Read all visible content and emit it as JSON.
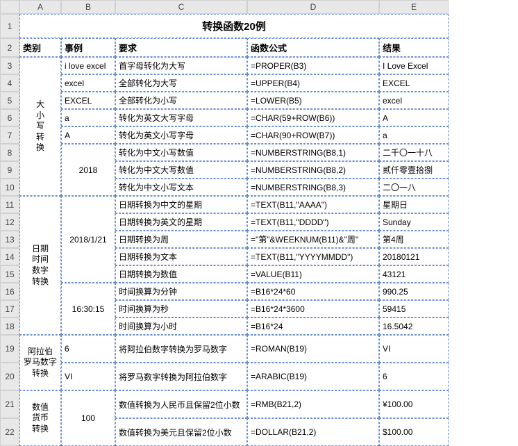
{
  "colHeaders": [
    "A",
    "B",
    "C",
    "D",
    "E"
  ],
  "rowHeaders": [
    "1",
    "2",
    "3",
    "4",
    "5",
    "6",
    "7",
    "8",
    "9",
    "10",
    "11",
    "12",
    "13",
    "14",
    "15",
    "16",
    "17",
    "18",
    "19",
    "20",
    "21",
    "22"
  ],
  "title": "转换函数20例",
  "headers": {
    "a": "类别",
    "b": "事例",
    "c": "要求",
    "d": "函数公式",
    "e": "结果"
  },
  "cat": {
    "case": [
      "大",
      "小",
      "写",
      "转",
      "换"
    ],
    "date": [
      "日期",
      "时间",
      "数字",
      "转换"
    ],
    "roman": [
      "阿拉伯",
      "罗马数字",
      "转换"
    ],
    "money": [
      "数值",
      "货币",
      "转换"
    ]
  },
  "ex": {
    "b3": "i love excel",
    "b4": "excel",
    "b5": "EXCEL",
    "b6": "a",
    "b7": "A",
    "b8": "2018",
    "b11": "2018/1/21",
    "b16": "16:30:15",
    "b19": "6",
    "b20": "VI",
    "b21": "100"
  },
  "req": {
    "r3": "首字母转化为大写",
    "r4": "全部转化为大写",
    "r5": "全部转化为小写",
    "r6": "转化为英文大写字母",
    "r7": "转化为英文小写字母",
    "r8": "转化为中文小写数值",
    "r9": "转化为中文大写数值",
    "r10": "转化为中文小写文本",
    "r11": "日期转换为中文的星期",
    "r12": "日期转换为英文的星期",
    "r13": "日期转换为周",
    "r14": "日期转换为文本",
    "r15": "日期转换为数值",
    "r16": "时间换算为分钟",
    "r17": "时间换算为秒",
    "r18": "时间换算为小时",
    "r19": "将阿拉伯数字转换为罗马数字",
    "r20": "将罗马数字转换为阿拉伯数字",
    "r21": "数值转换为人民币且保留2位小数",
    "r22": "数值转换为美元且保留2位小数"
  },
  "fn": {
    "f3": "=PROPER(B3)",
    "f4": "=UPPER(B4)",
    "f5": "=LOWER(B5)",
    "f6": "=CHAR(59+ROW(B6))",
    "f7": "=CHAR(90+ROW(B7))",
    "f8": "=NUMBERSTRING(B8,1)",
    "f9": "=NUMBERSTRING(B8,2)",
    "f10": "=NUMBERSTRING(B8,3)",
    "f11": "=TEXT(B11,\"AAAA\")",
    "f12": "=TEXT(B11,\"DDDD\")",
    "f13": "=\"第\"&WEEKNUM(B11)&\"周\"",
    "f14": "=TEXT(B11,\"YYYYMMDD\")",
    "f15": "=VALUE(B11)",
    "f16": "=B16*24*60",
    "f17": "=B16*24*3600",
    "f18": "=B16*24",
    "f19": "=ROMAN(B19)",
    "f20": "=ARABIC(B19)",
    "f21": "=RMB(B21,2)",
    "f22": "=DOLLAR(B21,2)"
  },
  "res": {
    "e3": "I Love Excel",
    "e4": "EXCEL",
    "e5": "excel",
    "e6": "A",
    "e7": "a",
    "e8": "二千〇一十八",
    "e9": "贰仟零壹拾捌",
    "e10": "二〇一八",
    "e11": "星期日",
    "e12": "Sunday",
    "e13": "第4周",
    "e14": "20180121",
    "e15": "43121",
    "e16": "990.25",
    "e17": "59415",
    "e18": "16.5042",
    "e19": "VI",
    "e20": "6",
    "e21": "¥100.00",
    "e22": "$100.00"
  }
}
